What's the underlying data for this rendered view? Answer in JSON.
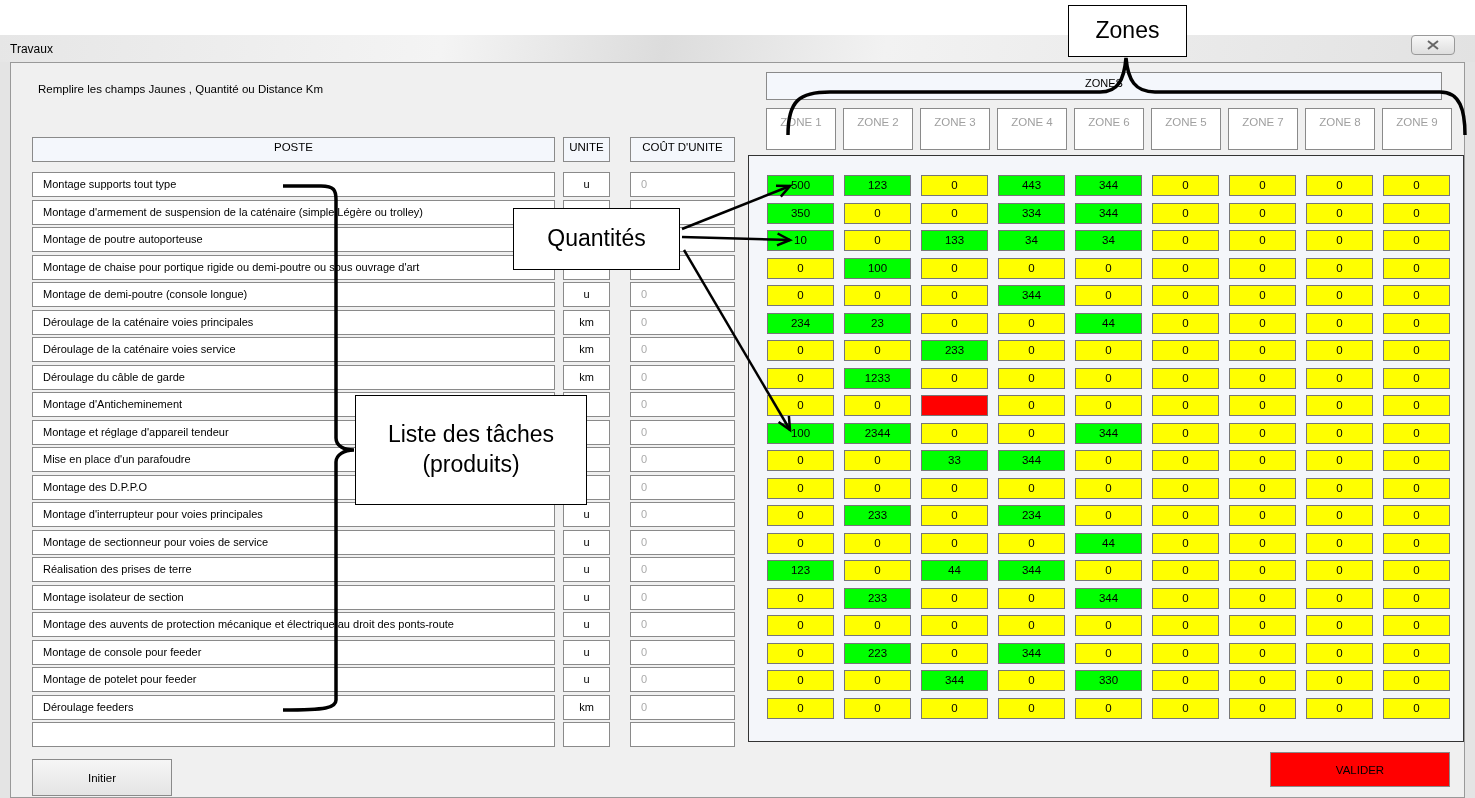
{
  "window": {
    "title": "Travaux"
  },
  "instruction": "Remplire les champs Jaunes  , Quantité ou Distance Km",
  "columns": [
    "POSTE",
    "UNITE",
    "COÛT D'UNITE"
  ],
  "zones_title": "ZONES",
  "zones": [
    "ZONE 1",
    "ZONE 2",
    "ZONE 3",
    "ZONE 4",
    "ZONE 6",
    "ZONE 5",
    "ZONE 7",
    "ZONE 8",
    "ZONE 9"
  ],
  "tasks": [
    {
      "name": "Montage supports tout type",
      "unit": "u",
      "cost": "0"
    },
    {
      "name": "Montage d'armement de suspension de la caténaire (simple Légère ou trolley)"
    },
    {
      "name": "Montage de poutre autoporteuse"
    },
    {
      "name": "Montage de chaise pour portique rigide ou demi-poutre ou sous ouvrage d'art"
    },
    {
      "name": "Montage de demi-poutre (console longue)",
      "unit": "u",
      "cost": "0"
    },
    {
      "name": "Déroulage de la caténaire voies principales",
      "unit": "km",
      "cost": "0"
    },
    {
      "name": "Déroulage de la caténaire voies service",
      "unit": "km",
      "cost": "0"
    },
    {
      "name": "Déroulage du câble de garde",
      "unit": "km",
      "cost": "0"
    },
    {
      "name": "Montage d'Anticheminement",
      "cost": "0"
    },
    {
      "name": "Montage et réglage d'appareil tendeur",
      "cost": "0"
    },
    {
      "name": "Mise en place d'un parafoudre",
      "cost": "0"
    },
    {
      "name": "Montage des D.P.P.O",
      "cost": "0"
    },
    {
      "name": "Montage d'interrupteur pour voies principales",
      "unit": "u",
      "cost": "0"
    },
    {
      "name": "Montage de sectionneur pour voies de service",
      "unit": "u",
      "cost": "0"
    },
    {
      "name": "Réalisation des prises de terre",
      "unit": "u",
      "cost": "0"
    },
    {
      "name": "Montage isolateur de section",
      "unit": "u",
      "cost": "0"
    },
    {
      "name": "Montage des auvents de protection mécanique et électrique au droit des ponts-route",
      "unit": "u",
      "cost": "0"
    },
    {
      "name": "Montage de console pour feeder",
      "unit": "u",
      "cost": "0"
    },
    {
      "name": "Montage de potelet pour feeder",
      "unit": "u",
      "cost": "0"
    },
    {
      "name": "Déroulage feeders",
      "unit": "km",
      "cost": "0"
    }
  ],
  "quantities": [
    [
      {
        "value": "500",
        "color": "#00ff00"
      },
      {
        "value": "123",
        "color": "#00ff00"
      },
      {
        "value": "0",
        "color": "#ffff00"
      },
      {
        "value": "443",
        "color": "#00ff00"
      },
      {
        "value": "344",
        "color": "#00ff00"
      },
      {
        "value": "0",
        "color": "#ffff00"
      },
      {
        "value": "0",
        "color": "#ffff00"
      },
      {
        "value": "0",
        "color": "#ffff00"
      },
      {
        "value": "0",
        "color": "#ffff00"
      }
    ],
    [
      {
        "value": "350",
        "color": "#00ff00"
      },
      {
        "value": "0",
        "color": "#ffff00"
      },
      {
        "value": "0",
        "color": "#ffff00"
      },
      {
        "value": "334",
        "color": "#00ff00"
      },
      {
        "value": "344",
        "color": "#00ff00"
      },
      {
        "value": "0",
        "color": "#ffff00"
      },
      {
        "value": "0",
        "color": "#ffff00"
      },
      {
        "value": "0",
        "color": "#ffff00"
      },
      {
        "value": "0",
        "color": "#ffff00"
      }
    ],
    [
      {
        "value": "10",
        "color": "#00ff00"
      },
      {
        "value": "0",
        "color": "#ffff00"
      },
      {
        "value": "133",
        "color": "#00ff00"
      },
      {
        "value": "34",
        "color": "#00ff00"
      },
      {
        "value": "34",
        "color": "#00ff00"
      },
      {
        "value": "0",
        "color": "#ffff00"
      },
      {
        "value": "0",
        "color": "#ffff00"
      },
      {
        "value": "0",
        "color": "#ffff00"
      },
      {
        "value": "0",
        "color": "#ffff00"
      }
    ],
    [
      {
        "value": "0",
        "color": "#ffff00"
      },
      {
        "value": "100",
        "color": "#00ff00"
      },
      {
        "value": "0",
        "color": "#ffff00"
      },
      {
        "value": "0",
        "color": "#ffff00"
      },
      {
        "value": "0",
        "color": "#ffff00"
      },
      {
        "value": "0",
        "color": "#ffff00"
      },
      {
        "value": "0",
        "color": "#ffff00"
      },
      {
        "value": "0",
        "color": "#ffff00"
      },
      {
        "value": "0",
        "color": "#ffff00"
      }
    ],
    [
      {
        "value": "0",
        "color": "#ffff00"
      },
      {
        "value": "0",
        "color": "#ffff00"
      },
      {
        "value": "0",
        "color": "#ffff00"
      },
      {
        "value": "344",
        "color": "#00ff00"
      },
      {
        "value": "0",
        "color": "#ffff00"
      },
      {
        "value": "0",
        "color": "#ffff00"
      },
      {
        "value": "0",
        "color": "#ffff00"
      },
      {
        "value": "0",
        "color": "#ffff00"
      },
      {
        "value": "0",
        "color": "#ffff00"
      }
    ],
    [
      {
        "value": "234",
        "color": "#00ff00"
      },
      {
        "value": "23",
        "color": "#00ff00"
      },
      {
        "value": "0",
        "color": "#ffff00"
      },
      {
        "value": "0",
        "color": "#ffff00"
      },
      {
        "value": "44",
        "color": "#00ff00"
      },
      {
        "value": "0",
        "color": "#ffff00"
      },
      {
        "value": "0",
        "color": "#ffff00"
      },
      {
        "value": "0",
        "color": "#ffff00"
      },
      {
        "value": "0",
        "color": "#ffff00"
      }
    ],
    [
      {
        "value": "0",
        "color": "#ffff00"
      },
      {
        "value": "0",
        "color": "#ffff00"
      },
      {
        "value": "233",
        "color": "#00ff00"
      },
      {
        "value": "0",
        "color": "#ffff00"
      },
      {
        "value": "0",
        "color": "#ffff00"
      },
      {
        "value": "0",
        "color": "#ffff00"
      },
      {
        "value": "0",
        "color": "#ffff00"
      },
      {
        "value": "0",
        "color": "#ffff00"
      },
      {
        "value": "0",
        "color": "#ffff00"
      }
    ],
    [
      {
        "value": "0",
        "color": "#ffff00"
      },
      {
        "value": "1233",
        "color": "#00ff00"
      },
      {
        "value": "0",
        "color": "#ffff00"
      },
      {
        "value": "0",
        "color": "#ffff00"
      },
      {
        "value": "0",
        "color": "#ffff00"
      },
      {
        "value": "0",
        "color": "#ffff00"
      },
      {
        "value": "0",
        "color": "#ffff00"
      },
      {
        "value": "0",
        "color": "#ffff00"
      },
      {
        "value": "0",
        "color": "#ffff00"
      }
    ],
    [
      {
        "value": "0",
        "color": "#ffff00"
      },
      {
        "value": "0",
        "color": "#ffff00"
      },
      {
        "color": "#ff0000"
      },
      {
        "value": "0",
        "color": "#ffff00"
      },
      {
        "value": "0",
        "color": "#ffff00"
      },
      {
        "value": "0",
        "color": "#ffff00"
      },
      {
        "value": "0",
        "color": "#ffff00"
      },
      {
        "value": "0",
        "color": "#ffff00"
      },
      {
        "value": "0",
        "color": "#ffff00"
      }
    ],
    [
      {
        "value": "100",
        "color": "#00ff00"
      },
      {
        "value": "2344",
        "color": "#00ff00"
      },
      {
        "value": "0",
        "color": "#ffff00"
      },
      {
        "value": "0",
        "color": "#ffff00"
      },
      {
        "value": "344",
        "color": "#00ff00"
      },
      {
        "value": "0",
        "color": "#ffff00"
      },
      {
        "value": "0",
        "color": "#ffff00"
      },
      {
        "value": "0",
        "color": "#ffff00"
      },
      {
        "value": "0",
        "color": "#ffff00"
      }
    ],
    [
      {
        "value": "0",
        "color": "#ffff00"
      },
      {
        "value": "0",
        "color": "#ffff00"
      },
      {
        "value": "33",
        "color": "#00ff00"
      },
      {
        "value": "344",
        "color": "#00ff00"
      },
      {
        "value": "0",
        "color": "#ffff00"
      },
      {
        "value": "0",
        "color": "#ffff00"
      },
      {
        "value": "0",
        "color": "#ffff00"
      },
      {
        "value": "0",
        "color": "#ffff00"
      },
      {
        "value": "0",
        "color": "#ffff00"
      }
    ],
    [
      {
        "value": "0",
        "color": "#ffff00"
      },
      {
        "value": "0",
        "color": "#ffff00"
      },
      {
        "value": "0",
        "color": "#ffff00"
      },
      {
        "value": "0",
        "color": "#ffff00"
      },
      {
        "value": "0",
        "color": "#ffff00"
      },
      {
        "value": "0",
        "color": "#ffff00"
      },
      {
        "value": "0",
        "color": "#ffff00"
      },
      {
        "value": "0",
        "color": "#ffff00"
      },
      {
        "value": "0",
        "color": "#ffff00"
      }
    ],
    [
      {
        "value": "0",
        "color": "#ffff00"
      },
      {
        "value": "233",
        "color": "#00ff00"
      },
      {
        "value": "0",
        "color": "#ffff00"
      },
      {
        "value": "234",
        "color": "#00ff00"
      },
      {
        "value": "0",
        "color": "#ffff00"
      },
      {
        "value": "0",
        "color": "#ffff00"
      },
      {
        "value": "0",
        "color": "#ffff00"
      },
      {
        "value": "0",
        "color": "#ffff00"
      },
      {
        "value": "0",
        "color": "#ffff00"
      }
    ],
    [
      {
        "value": "0",
        "color": "#ffff00"
      },
      {
        "value": "0",
        "color": "#ffff00"
      },
      {
        "value": "0",
        "color": "#ffff00"
      },
      {
        "value": "0",
        "color": "#ffff00"
      },
      {
        "value": "44",
        "color": "#00ff00"
      },
      {
        "value": "0",
        "color": "#ffff00"
      },
      {
        "value": "0",
        "color": "#ffff00"
      },
      {
        "value": "0",
        "color": "#ffff00"
      },
      {
        "value": "0",
        "color": "#ffff00"
      }
    ],
    [
      {
        "value": "123",
        "color": "#00ff00"
      },
      {
        "value": "0",
        "color": "#ffff00"
      },
      {
        "value": "44",
        "color": "#00ff00"
      },
      {
        "value": "344",
        "color": "#00ff00"
      },
      {
        "value": "0",
        "color": "#ffff00"
      },
      {
        "value": "0",
        "color": "#ffff00"
      },
      {
        "value": "0",
        "color": "#ffff00"
      },
      {
        "value": "0",
        "color": "#ffff00"
      },
      {
        "value": "0",
        "color": "#ffff00"
      }
    ],
    [
      {
        "value": "0",
        "color": "#ffff00"
      },
      {
        "value": "233",
        "color": "#00ff00"
      },
      {
        "value": "0",
        "color": "#ffff00"
      },
      {
        "value": "0",
        "color": "#ffff00"
      },
      {
        "value": "344",
        "color": "#00ff00"
      },
      {
        "value": "0",
        "color": "#ffff00"
      },
      {
        "value": "0",
        "color": "#ffff00"
      },
      {
        "value": "0",
        "color": "#ffff00"
      },
      {
        "value": "0",
        "color": "#ffff00"
      }
    ],
    [
      {
        "value": "0",
        "color": "#ffff00"
      },
      {
        "value": "0",
        "color": "#ffff00"
      },
      {
        "value": "0",
        "color": "#ffff00"
      },
      {
        "value": "0",
        "color": "#ffff00"
      },
      {
        "value": "0",
        "color": "#ffff00"
      },
      {
        "value": "0",
        "color": "#ffff00"
      },
      {
        "value": "0",
        "color": "#ffff00"
      },
      {
        "value": "0",
        "color": "#ffff00"
      },
      {
        "value": "0",
        "color": "#ffff00"
      }
    ],
    [
      {
        "value": "0",
        "color": "#ffff00"
      },
      {
        "value": "223",
        "color": "#00ff00"
      },
      {
        "value": "0",
        "color": "#ffff00"
      },
      {
        "value": "344",
        "color": "#00ff00"
      },
      {
        "value": "0",
        "color": "#ffff00"
      },
      {
        "value": "0",
        "color": "#ffff00"
      },
      {
        "value": "0",
        "color": "#ffff00"
      },
      {
        "value": "0",
        "color": "#ffff00"
      },
      {
        "value": "0",
        "color": "#ffff00"
      }
    ],
    [
      {
        "value": "0",
        "color": "#ffff00"
      },
      {
        "value": "0",
        "color": "#ffff00"
      },
      {
        "value": "344",
        "color": "#00ff00"
      },
      {
        "value": "0",
        "color": "#ffff00"
      },
      {
        "value": "330",
        "color": "#00ff00"
      },
      {
        "value": "0",
        "color": "#ffff00"
      },
      {
        "value": "0",
        "color": "#ffff00"
      },
      {
        "value": "0",
        "color": "#ffff00"
      },
      {
        "value": "0",
        "color": "#ffff00"
      }
    ],
    [
      {
        "value": "0",
        "color": "#ffff00"
      },
      {
        "value": "0",
        "color": "#ffff00"
      },
      {
        "value": "0",
        "color": "#ffff00"
      },
      {
        "value": "0",
        "color": "#ffff00"
      },
      {
        "value": "0",
        "color": "#ffff00"
      },
      {
        "value": "0",
        "color": "#ffff00"
      },
      {
        "value": "0",
        "color": "#ffff00"
      },
      {
        "value": "0",
        "color": "#ffff00"
      },
      {
        "value": "0",
        "color": "#ffff00"
      }
    ]
  ],
  "buttons": {
    "reset": "Initier",
    "submit": "VALIDER"
  },
  "annotations": [
    {
      "text": "Zones"
    },
    {
      "text": "Quantités"
    },
    {
      "text": "Liste des tâches (produits)"
    }
  ]
}
